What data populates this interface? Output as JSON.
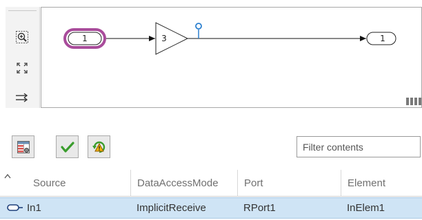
{
  "model": {
    "inport_number": "1",
    "gain_value": "3",
    "outport_number": "1"
  },
  "palette": {
    "items": [
      {
        "icon": "zoom-in-icon"
      },
      {
        "icon": "fit-to-view-icon"
      },
      {
        "icon": "signal-arrows-icon"
      }
    ]
  },
  "toolbar": {
    "buttons": [
      {
        "icon": "table-settings-icon"
      },
      {
        "icon": "checkmark-icon"
      },
      {
        "icon": "refresh-warning-icon"
      }
    ],
    "filter_placeholder": "Filter contents"
  },
  "table": {
    "columns": [
      "Source",
      "DataAccessMode",
      "Port",
      "Element"
    ],
    "rows": [
      {
        "source": "In1",
        "data_access_mode": "ImplicitReceive",
        "port": "RPort1",
        "element": "InElem1"
      }
    ]
  },
  "colors": {
    "inport_highlight": "#a94c9b",
    "selected_row": "#cfe4f5",
    "test_point": "#2a7fcf"
  }
}
